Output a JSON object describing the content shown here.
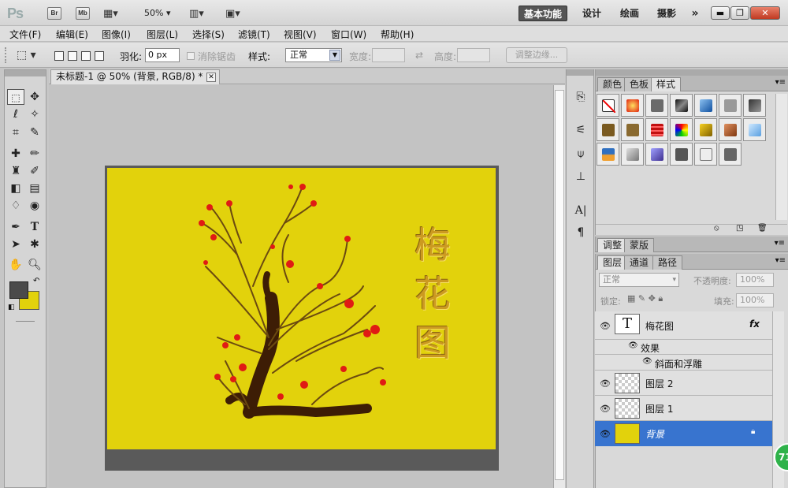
{
  "app": {
    "logo": "Ps"
  },
  "titlebar": {
    "bridge_label": "Br",
    "minibridge_label": "Mb",
    "zoom": "50%",
    "workspaces": [
      "基本功能",
      "设计",
      "绘画",
      "摄影"
    ],
    "more": "»"
  },
  "menu": [
    "文件(F)",
    "编辑(E)",
    "图像(I)",
    "图层(L)",
    "选择(S)",
    "滤镜(T)",
    "视图(V)",
    "窗口(W)",
    "帮助(H)"
  ],
  "options": {
    "feather_label": "羽化:",
    "feather_value": "0 px",
    "antialias_label": "消除锯齿",
    "style_label": "样式:",
    "style_value": "正常",
    "width_label": "宽度:",
    "height_label": "高度:",
    "refine_button": "调整边缘..."
  },
  "document": {
    "tab_title": "未标题-1 @ 50% (背景, RGB/8) *",
    "canvas_text": [
      "梅",
      "花",
      "图"
    ]
  },
  "top_panel": {
    "tabs": [
      "颜色",
      "色板",
      "样式"
    ],
    "active_tab": "样式",
    "styles": [
      "none",
      "red-glow",
      "gray",
      "dark-chrome",
      "blue-glass",
      "light-gray",
      "dark-gray",
      "bronze",
      "bronze2",
      "red-stripes",
      "rainbow",
      "gold",
      "copper",
      "light-blue",
      "sunset",
      "photo",
      "purple",
      "charcoal",
      "white-frame",
      "outline-gray"
    ]
  },
  "adjust_panel": {
    "tabs": [
      "调整",
      "蒙版"
    ],
    "active_tab": "调整"
  },
  "layers_panel": {
    "tabs": [
      "图层",
      "通道",
      "路径"
    ],
    "active_tab": "图层",
    "blend_mode": "正常",
    "opacity_label": "不透明度:",
    "opacity_value": "100%",
    "lock_label": "锁定:",
    "fill_label": "填充:",
    "fill_value": "100%",
    "layers": [
      {
        "name": "梅花图",
        "type": "text",
        "thumb": "T",
        "fx": "fx"
      },
      {
        "name": "效果",
        "type": "effects-header"
      },
      {
        "name": "斜面和浮雕",
        "type": "effect"
      },
      {
        "name": "图层 2",
        "type": "pixel"
      },
      {
        "name": "图层 1",
        "type": "pixel"
      },
      {
        "name": "背景",
        "type": "background",
        "selected": true
      }
    ]
  },
  "badge": "71",
  "colors": {
    "foreground": "#4a4a4a",
    "background": "#e2d20c",
    "accent": "#3874cf",
    "canvas": "#e2d20c"
  }
}
